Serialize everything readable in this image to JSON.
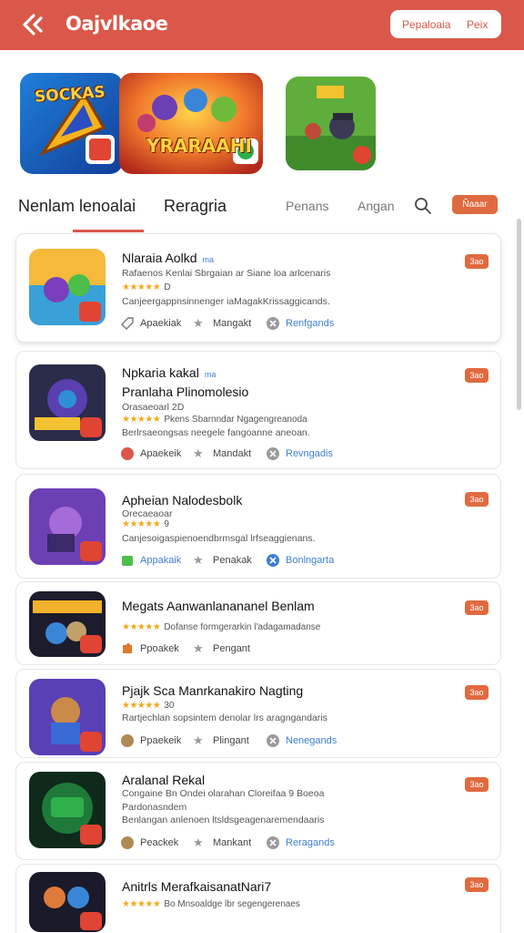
{
  "header": {
    "title": "Oajvlkaoe",
    "pill_left": "Pepaloaia",
    "pill_right": "Peix"
  },
  "featured": [
    {
      "label": "SOCKAS"
    },
    {
      "label": "YRARAAHI"
    },
    {
      "label": ""
    }
  ],
  "tabs": {
    "active": "Nenlam lenoalai",
    "second": "Reragria",
    "third": "Penans",
    "fourth": "Angan",
    "sort": "Ñaaar"
  },
  "games": [
    {
      "title": "Nlaraia Aolkd",
      "tag": "ma",
      "subtitle": "",
      "desc": "Rafaenos Kenlai Sbrgaian ar Siane loa arlcenaris",
      "rating_stars": "★★★★★",
      "rating_meta": "D",
      "body": "Canjeergappnsinnenger iaMagakKrissaggicands.",
      "action1": "Apaekiak",
      "action2": "Mangakt",
      "action3": "Renfgands",
      "price": "3ao"
    },
    {
      "title": "Npkaria kakal",
      "tag": "ma",
      "subtitle": "Pranlaha Plinomolesio",
      "desc": "Orasaeoarl 2D",
      "rating_stars": "★★★★★",
      "rating_meta": "Pkens Sbarnndar Ngagengreanoda",
      "body": "Berlrsaeongsas neegele fangoanne aneoan.",
      "action1": "Apaekeik",
      "action2": "Mandakt",
      "action3": "Revngadis",
      "price": "3ao"
    },
    {
      "title": "Apheian Nalodesbolk",
      "tag": "",
      "subtitle": "",
      "desc": "Orecaeaoar",
      "rating_stars": "★★★★★",
      "rating_meta": "9",
      "body": "Canjesoigaspienoendbrmsgal lrfseaggienans.",
      "action1": "Appakaik",
      "action2": "Penakak",
      "action3": "Bonlngarta",
      "price": "3ao"
    },
    {
      "title": "Megats Aanwanlanananel Benlam",
      "tag": "",
      "subtitle": "",
      "desc": "",
      "rating_stars": "★★★★★",
      "rating_meta": "Dofanse formgerarkin l'adagamadanse",
      "body": "",
      "action1": "Ppoakek",
      "action2": "Pengant",
      "action3": "",
      "price": "3ao"
    },
    {
      "title": "Pjajk Sca Manrkanakiro Nagting",
      "tag": "",
      "subtitle": "",
      "desc": "",
      "rating_stars": "★★★★★",
      "rating_meta": "30",
      "body": "Rartjechlan sopsintem denolar lrs aragngandaris",
      "action1": "Ppaekeik",
      "action2": "Plingant",
      "action3": "Nenegands",
      "price": "3ao"
    },
    {
      "title": "Aralanal Rekal",
      "tag": "",
      "subtitle": "",
      "desc": "Congaine Bn Ondei olarahan Cloreifaa 9 Boeoa",
      "rating_stars": "",
      "rating_meta": "",
      "body": "Pardonasndem",
      "body2": "Benlangan anlenoen ltsldsgeagenaremendaaris",
      "action1": "Peackek",
      "action2": "Mankant",
      "action3": "Reragands",
      "price": "3ao"
    },
    {
      "title": "Anitrls MerafkaisanatNari7",
      "tag": "",
      "subtitle": "",
      "desc": "",
      "rating_stars": "★★★★★",
      "rating_meta": "Bo Mnsoaldge lbr segengerenaes",
      "body": "",
      "action1": "",
      "action2": "",
      "action3": "",
      "price": "3ao"
    }
  ],
  "colors": {
    "brand": "#d9584a",
    "accent_orange": "#e06a3f",
    "link_blue": "#3d7fd3",
    "star": "#f2a81d"
  }
}
